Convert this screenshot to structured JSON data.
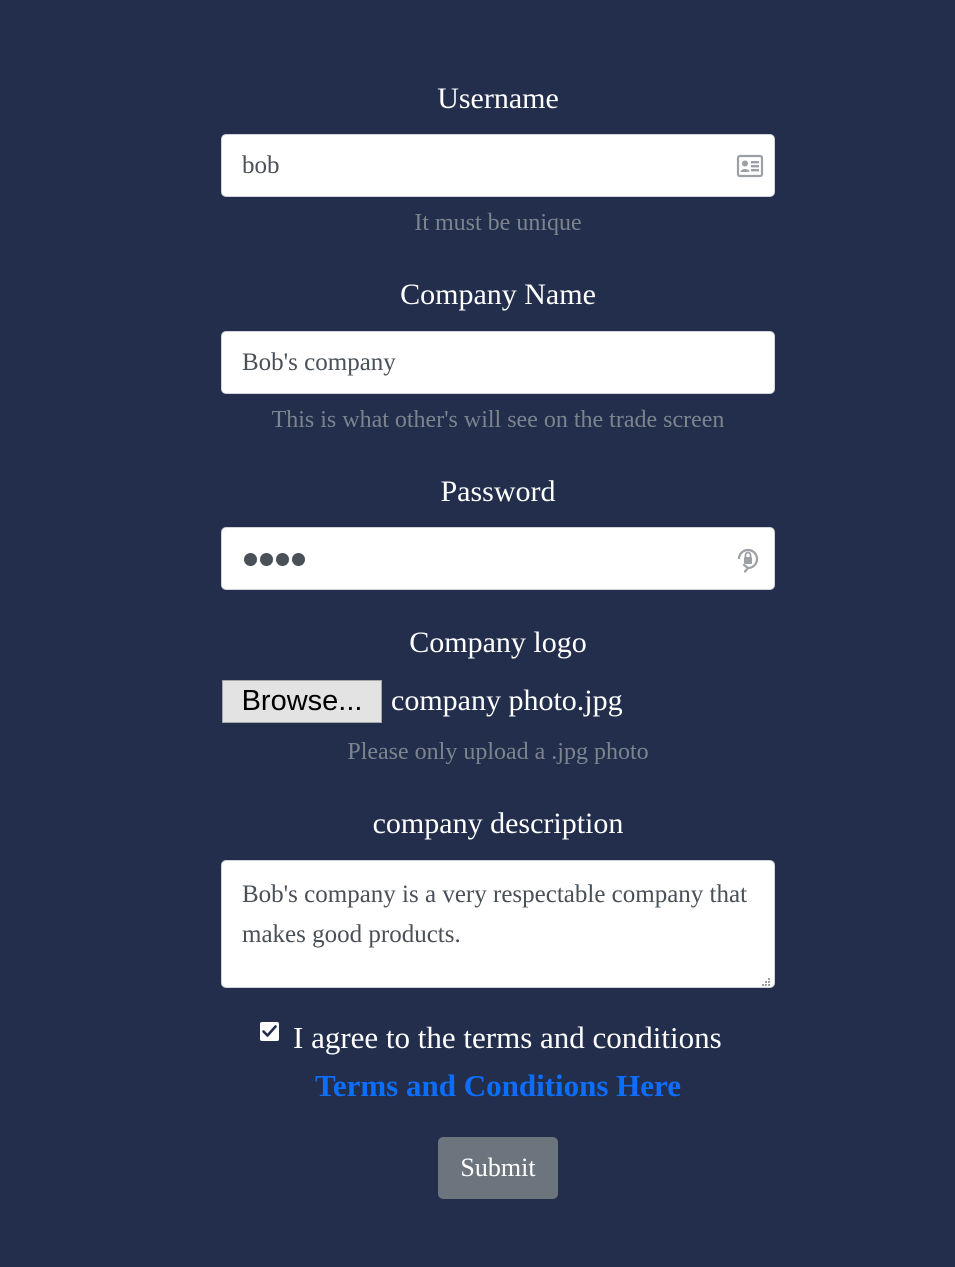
{
  "form": {
    "username": {
      "label": "Username",
      "value": "bob",
      "hint": "It must be unique",
      "icon": "contact-card-icon"
    },
    "company_name": {
      "label": "Company Name",
      "value": "Bob's company",
      "hint": "This is what other's will see on the trade screen"
    },
    "password": {
      "label": "Password",
      "masked_length": 4,
      "icon": "password-lock-icon"
    },
    "company_logo": {
      "label": "Company logo",
      "browse_label": "Browse...",
      "file_name": "company photo.jpg",
      "hint": "Please only upload a .jpg photo"
    },
    "company_description": {
      "label": "company description",
      "value": "Bob's company is a very respectable company that makes good products."
    },
    "terms": {
      "checked": true,
      "label": "I agree to the terms and conditions",
      "link_text": "Terms and Conditions Here"
    },
    "submit_label": "Submit"
  },
  "colors": {
    "background": "#222e4b",
    "link": "#0d6efd",
    "submit_button": "#6c757d",
    "hint_text": "#7c848e"
  }
}
